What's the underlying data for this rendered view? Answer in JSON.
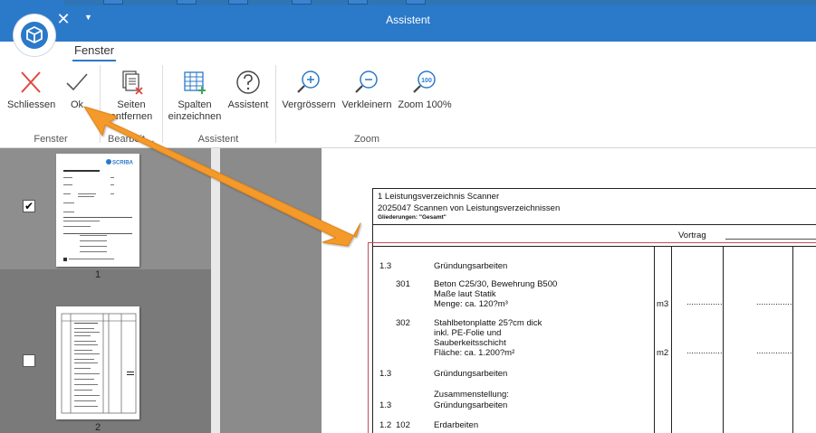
{
  "window": {
    "title": "Assistent",
    "close_glyph": "✕",
    "dropdown_glyph": "▼"
  },
  "tabs": [
    {
      "label": "Fenster"
    }
  ],
  "ribbon": {
    "buttons": {
      "schliessen": {
        "label": "Schliessen",
        "icon": "x-icon"
      },
      "ok": {
        "label": "Ok",
        "icon": "checkmark-icon"
      },
      "seiten_entfernen": {
        "label1": "Seiten",
        "label2": "entfernen",
        "icon": "remove-pages-icon"
      },
      "spalten_einzeichnen": {
        "label1": "Spalten",
        "label2": "einzeichnen",
        "icon": "draw-columns-icon"
      },
      "assistent": {
        "label": "Assistent",
        "icon": "question-icon"
      },
      "vergroessern": {
        "label": "Vergrössern",
        "icon": "zoom-in-icon"
      },
      "verkleinern": {
        "label": "Verkleinern",
        "icon": "zoom-out-icon"
      },
      "zoom100": {
        "label": "Zoom 100%",
        "icon": "zoom-100-icon"
      }
    },
    "groups": {
      "fenster": "Fenster",
      "bearbeiten": "Bearbeit…",
      "assistent": "Assistent",
      "zoom": "Zoom"
    }
  },
  "thumbnails": [
    {
      "page": "1",
      "checked": true,
      "check_glyph": "✔",
      "brand": "SCRIBA"
    },
    {
      "page": "2",
      "checked": false,
      "check_glyph": ""
    }
  ],
  "document": {
    "header_line1": "1 Leistungsverzeichnis Scanner",
    "header_line2": "2025047 Scannen von Leistungsverzeichnissen",
    "header_line3": "Gliederungen: \"Gesamt\"",
    "vortrag": "Vortrag",
    "rows": [
      {
        "pos": "1.3",
        "text": "Gründungsarbeiten"
      },
      {
        "pos": "301",
        "lines": [
          "Beton C25/30, Bewehrung B500",
          "Maße laut Statik",
          "Menge: ca. 120?m³"
        ],
        "unit": "m3",
        "dots1": "...............",
        "dots2": "..............."
      },
      {
        "pos": "302",
        "lines": [
          "Stahlbetonplatte 25?cm dick",
          "inkl. PE-Folie und",
          "Sauberkeitsschicht",
          "Fläche: ca. 1.200?m²"
        ],
        "unit": "m2",
        "dots1": "...............",
        "dots2": "..............."
      },
      {
        "pos": "1.3",
        "text": "Gründungsarbeiten"
      },
      {
        "pos": "1.3",
        "lines": [
          "Zusammenstellung:",
          "Gründungsarbeiten"
        ]
      },
      {
        "pos": "1.2",
        "sub": "102",
        "text": "Erdarbeiten"
      }
    ]
  },
  "colors": {
    "titlebar": "#2b79c9",
    "arrow": "#f39a2b",
    "accent": "#2b79c9"
  }
}
